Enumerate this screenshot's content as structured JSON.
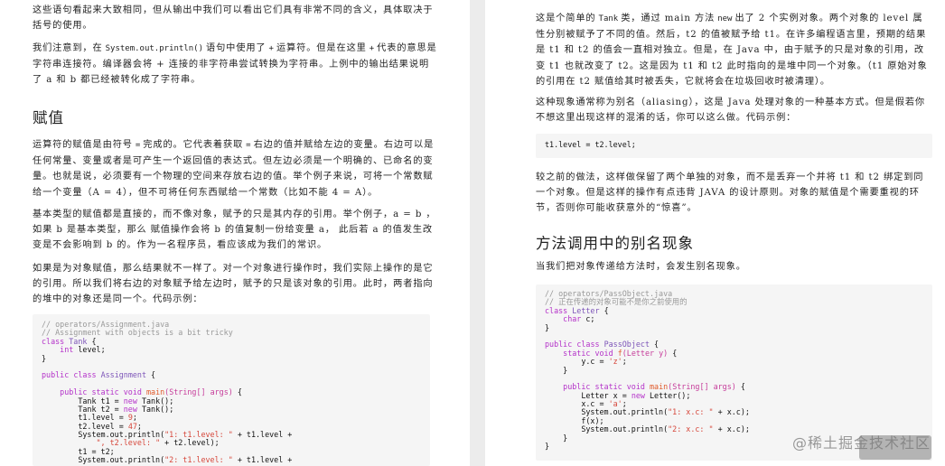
{
  "left": {
    "p1": "这些语句看起来大致相同，但从输出中我们可以看出它们具有非常不同的含义，具体取决于括号的使用。",
    "p2": {
      "pre": "我们注意到，在",
      "code1": "System.out.println()",
      "mid1": "语句中使用了",
      "code2": "+",
      "mid2": "运算符。但是在这里",
      "code3": "+",
      "post": "代表的意思是字符串连接符。编译器会将 + 连接的非字符串尝试转换为字符串。上例中的输出结果说明了 a 和 b 都已经被转化成了字符串。"
    },
    "heading": "赋值",
    "p3": {
      "pre": "运算符的赋值是由符号",
      "code1": "=",
      "mid": "完成的。它代表着获取",
      "code2": "=",
      "post": "右边的值并赋给左边的变量。右边可以是任何常量、变量或者是可产生一个返回值的表达式。但左边必须是一个明确的、已命名的变量。也就是说，必须要有一个物理的空间来存放右边的值。举个例子来说，可将一个常数赋给一个变量（A = 4），但不可将任何东西赋给一个常数（比如不能 4 = A）。"
    },
    "p4": "基本类型的赋值都是直接的，而不像对象，赋予的只是其内存的引用。举个例子，a = b ，如果 b 是基本类型，那么 赋值操作会将 b 的值复制一份给变量 a， 此后若 a 的值发生改变是不会影响到 b 的。作为一名程序员，看应该成为我们的常识。",
    "p5": "如果是为对象赋值，那么结果就不一样了。对一个对象进行操作时，我们实际上操作的是它的引用。所以我们将右边的对象赋予给左边时，赋予的只是该对象的引用。此时，两者指向的堆中的对象还是同一个。代码示例：",
    "code": [
      [
        [
          "cm",
          "// operators/Assignment.java"
        ]
      ],
      [
        [
          "cm",
          "// Assignment with objects is a bit tricky"
        ]
      ],
      [
        [
          "kw",
          "class"
        ],
        [
          "",
          " "
        ],
        [
          "tp",
          "Tank"
        ],
        [
          "",
          " {"
        ]
      ],
      [
        [
          "",
          "    "
        ],
        [
          "kw",
          "int"
        ],
        [
          "",
          "",
          " "
        ],
        [
          "",
          "level;"
        ]
      ],
      [
        [
          "",
          "}"
        ]
      ],
      [
        [
          "",
          ""
        ]
      ],
      [
        [
          "kw",
          "public"
        ],
        [
          "",
          "",
          " "
        ],
        [
          "kw",
          "class"
        ],
        [
          "",
          "",
          " "
        ],
        [
          "tp",
          "Assignment"
        ],
        [
          "",
          " {"
        ]
      ],
      [
        [
          "",
          ""
        ]
      ],
      [
        [
          "",
          "    "
        ],
        [
          "kw",
          "public static void"
        ],
        [
          "",
          "",
          " "
        ],
        [
          "nm",
          "main"
        ],
        [
          "ct",
          "(String[] args)"
        ],
        [
          "",
          " {"
        ]
      ],
      [
        [
          "",
          "        Tank t1 = "
        ],
        [
          "kw",
          "new"
        ],
        [
          "",
          " Tank();"
        ]
      ],
      [
        [
          "",
          "        Tank t2 = "
        ],
        [
          "kw",
          "new"
        ],
        [
          "",
          " Tank();"
        ]
      ],
      [
        [
          "",
          "        t1.level = "
        ],
        [
          "st",
          "9"
        ],
        [
          "",
          ";"
        ]
      ],
      [
        [
          "",
          "        t2.level = "
        ],
        [
          "st",
          "47"
        ],
        [
          "",
          ";"
        ]
      ],
      [
        [
          "",
          "        System.out.println("
        ],
        [
          "st",
          "\"1: t1.level: \""
        ],
        [
          "",
          " + t1.level +"
        ]
      ],
      [
        [
          "",
          "            "
        ],
        [
          "st",
          "\", t2.level: \""
        ],
        [
          "",
          " + t2.level);"
        ]
      ],
      [
        [
          "",
          "        t1 = t2;"
        ]
      ],
      [
        [
          "",
          "        System.out.println("
        ],
        [
          "st",
          "\"2: t1.level: \""
        ],
        [
          "",
          " + t1.level +"
        ]
      ]
    ]
  },
  "right": {
    "p1": {
      "pre": "这是个简单的",
      "code1": "Tank",
      "mid1": "类，通过 main 方法",
      "code2": "new",
      "post": "出了 2 个实例对象。两个对象的 level 属性分别被赋予了不同的值。然后，t2 的值被赋予给 t1。在许多编程语言里，预期的结果是 t1 和 t2 的值会一直相对独立。但是，在 Java 中，由于赋予的只是对象的引用，改变 t1 也就改变了 t2。这是因为 t1 和 t2 此时指向的是堆中同一个对象。（t1 原始对象的引用在 t2 赋值给其时被丢失，它就将会在垃圾回收时被清理）。"
    },
    "p2": "这种现象通常称为别名（aliasing），这是 Java 处理对象的一种基本方式。但是假若你不想这里出现这样的混淆的话，你可以这么做。代码示例：",
    "inline_code": "t1.level = t2.level;",
    "p3": "较之前的做法，这样做保留了两个单独的对象，而不是丢弃一个并将 t1 和 t2 绑定到同一个对象。但是这样的操作有点违背 JAVA 的设计原则。对象的赋值是个需要重视的环节，否则你可能收获意外的“惊喜”。",
    "heading": "方法调用中的别名现象",
    "p4": "当我们把对象传递给方法时，会发生别名现象。",
    "code": [
      [
        [
          "cm",
          "// operators/PassObject.java"
        ]
      ],
      [
        [
          "cm",
          "// 正在传递的对象可能不是你之前使用的"
        ]
      ],
      [
        [
          "kw",
          "class"
        ],
        [
          "",
          " "
        ],
        [
          "tp",
          "Letter"
        ],
        [
          "",
          " {"
        ]
      ],
      [
        [
          "",
          "    "
        ],
        [
          "kw",
          "char"
        ],
        [
          "",
          " c;"
        ]
      ],
      [
        [
          "",
          "}"
        ]
      ],
      [
        [
          "",
          ""
        ]
      ],
      [
        [
          "kw",
          "public"
        ],
        [
          "",
          " "
        ],
        [
          "kw",
          "class"
        ],
        [
          "",
          " "
        ],
        [
          "tp",
          "PassObject"
        ],
        [
          "",
          " {"
        ]
      ],
      [
        [
          "",
          "    "
        ],
        [
          "kw",
          "static void"
        ],
        [
          "",
          " "
        ],
        [
          "nm",
          "f"
        ],
        [
          "ct",
          "(Letter y)"
        ],
        [
          "",
          " {"
        ]
      ],
      [
        [
          "",
          "        y.c = "
        ],
        [
          "st",
          "'z'"
        ],
        [
          "",
          ";"
        ]
      ],
      [
        [
          "",
          "    }"
        ]
      ],
      [
        [
          "",
          ""
        ]
      ],
      [
        [
          "",
          "    "
        ],
        [
          "kw",
          "public static void"
        ],
        [
          "",
          " "
        ],
        [
          "nm",
          "main"
        ],
        [
          "ct",
          "(String[] args)"
        ],
        [
          "",
          " {"
        ]
      ],
      [
        [
          "",
          "        Letter x = "
        ],
        [
          "kw",
          "new"
        ],
        [
          "",
          " Letter();"
        ]
      ],
      [
        [
          "",
          "        x.c = "
        ],
        [
          "st",
          "'a'"
        ],
        [
          "",
          ";"
        ]
      ],
      [
        [
          "",
          "        System.out.println("
        ],
        [
          "st",
          "\"1: x.c: \""
        ],
        [
          "",
          " + x.c);"
        ]
      ],
      [
        [
          "",
          "        f(x);"
        ]
      ],
      [
        [
          "",
          "        System.out.println("
        ],
        [
          "st",
          "\"2: x.c: \""
        ],
        [
          "",
          " + x.c);"
        ]
      ],
      [
        [
          "",
          "    }"
        ]
      ],
      [
        [
          "",
          "}"
        ]
      ]
    ]
  },
  "watermark": "@稀土掘金技术社区"
}
